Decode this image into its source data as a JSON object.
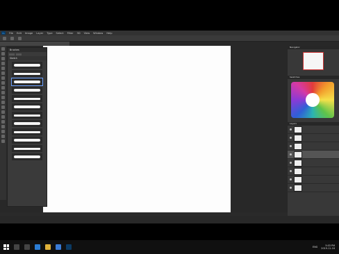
{
  "menubar": {
    "items": [
      "File",
      "Edit",
      "Image",
      "Layer",
      "Type",
      "Select",
      "Filter",
      "3D",
      "View",
      "Window",
      "Help"
    ]
  },
  "panels": {
    "brush_presets_title": "Brushes",
    "brush_folder": "Sketch",
    "navigator_title": "Navigator",
    "swatches_title": "Swatches",
    "layers_title": "Layers"
  },
  "taskbar": {
    "time": "5:03 PM",
    "date": "2019-11-16",
    "lang": "ENG"
  },
  "icons": [
    "windows-start-icon",
    "search-icon",
    "task-view-icon",
    "edge-icon",
    "file-explorer-icon",
    "store-icon",
    "photoshop-icon"
  ],
  "colors": {
    "app_bg": "#282828",
    "canvas": "#fdfdfd",
    "selection_outline": "#6aa0ff"
  }
}
